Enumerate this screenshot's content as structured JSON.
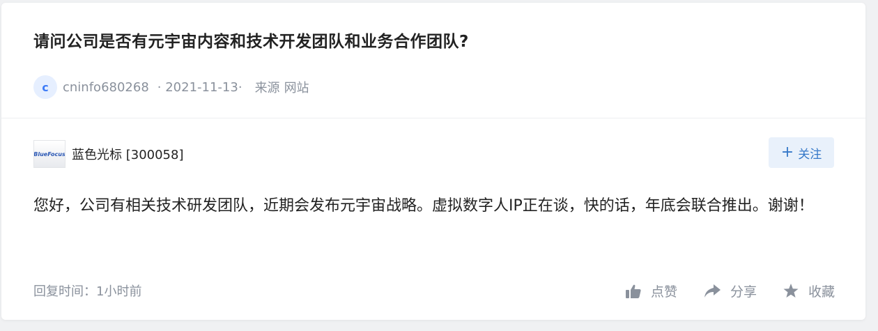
{
  "question": {
    "title": "请问公司是否有元宇宙内容和技术开发团队和业务合作团队?"
  },
  "meta": {
    "avatar_letter": "c",
    "username": "cninfo680268",
    "date": "· 2021-11-13·",
    "source_label": "来源",
    "source_value": "网站"
  },
  "company": {
    "logo_text": "BlueFocus",
    "name": "蓝色光标 [300058]",
    "follow_label": "关注"
  },
  "answer": {
    "text": "您好，公司有相关技术研发团队，近期会发布元宇宙战略。虚拟数字人IP正在谈，快的话，年底会联合推出。谢谢！"
  },
  "footer": {
    "reply_time": "回复时间：1小时前",
    "like_label": "点赞",
    "share_label": "分享",
    "collect_label": "收藏"
  },
  "colors": {
    "accent": "#3578c8",
    "muted": "#8a919c",
    "text": "#222222"
  }
}
